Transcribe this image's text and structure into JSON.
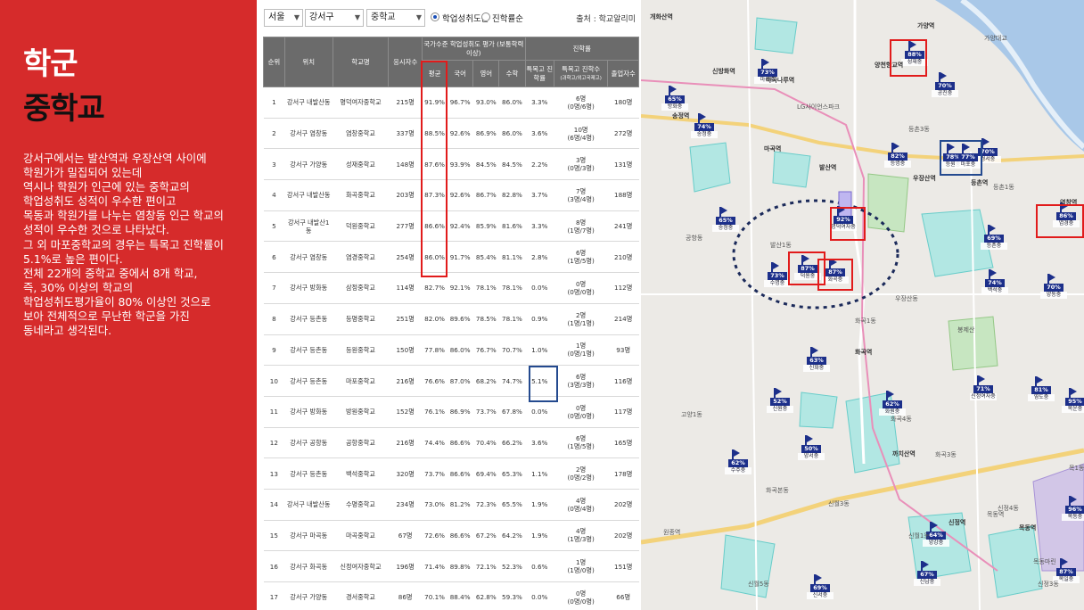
{
  "left_panel": {
    "title_main": "학군",
    "title_sub": "중학교",
    "description_lines": [
      "강서구에서는 발산역과 우장산역 사이에",
      "학원가가 밀집되어 있는데",
      "역시나 학원가 인근에 있는 중학교의",
      "학업성취도 성적이 우수한 편이고",
      "목동과 학원가를 나누는 염창동 인근 학교의",
      "성적이 우수한 것으로 나타났다.",
      "그 외 마포중학교의 경우는 특목고 진학률이",
      "5.1%로 높은 편이다.",
      "전체 22개의 중학교 중에서 8개 학교,",
      "즉, 30% 이상의 학교의",
      "학업성취도평가율이 80% 이상인 것으로",
      "보아 전체적으로 무난한 학군을 가진",
      "동네라고 생각된다."
    ]
  },
  "filters": {
    "city": "서울",
    "district": "강서구",
    "level": "중학교",
    "radio_1": "학업성취도순",
    "radio_2": "진학률순",
    "source": "출처 : 학교알리미"
  },
  "table": {
    "group_header_1": "국가수준 학업성취도 평가 (보통학력이상)",
    "group_header_2": "진학률",
    "headers": {
      "rank": "순위",
      "location": "위치",
      "school": "학교명",
      "examinees": "응시자수",
      "avg": "평균",
      "korean": "국어",
      "english": "영어",
      "math": "수학",
      "special_rate": "특목고 진학률",
      "special_count": "특목고 진학수",
      "special_count_sub": "(과학고/외고국제고)",
      "graduates": "졸업자수"
    },
    "rows": [
      {
        "rank": "1",
        "location": "강서구 내발산동",
        "school": "명덕여자중학교",
        "examinees": "215명",
        "avg": "91.9%",
        "korean": "96.7%",
        "english": "93.0%",
        "math": "86.0%",
        "special_rate": "3.3%",
        "count_top": "6명",
        "count_bot": "(0명/6명)",
        "graduates": "180명"
      },
      {
        "rank": "2",
        "location": "강서구 염창동",
        "school": "염창중학교",
        "examinees": "337명",
        "avg": "88.5%",
        "korean": "92.6%",
        "english": "86.9%",
        "math": "86.0%",
        "special_rate": "3.6%",
        "count_top": "10명",
        "count_bot": "(6명/4명)",
        "graduates": "272명"
      },
      {
        "rank": "3",
        "location": "강서구 가양동",
        "school": "성재중학교",
        "examinees": "148명",
        "avg": "87.6%",
        "korean": "93.9%",
        "english": "84.5%",
        "math": "84.5%",
        "special_rate": "2.2%",
        "count_top": "3명",
        "count_bot": "(0명/3명)",
        "graduates": "131명"
      },
      {
        "rank": "4",
        "location": "강서구 내발산동",
        "school": "화곡중학교",
        "examinees": "203명",
        "avg": "87.3%",
        "korean": "92.6%",
        "english": "86.7%",
        "math": "82.8%",
        "special_rate": "3.7%",
        "count_top": "7명",
        "count_bot": "(3명/4명)",
        "graduates": "188명"
      },
      {
        "rank": "5",
        "location": "강서구 내발산1동",
        "school": "덕원중학교",
        "examinees": "277명",
        "avg": "86.6%",
        "korean": "92.4%",
        "english": "85.9%",
        "math": "81.6%",
        "special_rate": "3.3%",
        "count_top": "8명",
        "count_bot": "(1명/7명)",
        "graduates": "241명"
      },
      {
        "rank": "6",
        "location": "강서구 염창동",
        "school": "염경중학교",
        "examinees": "254명",
        "avg": "86.0%",
        "korean": "91.7%",
        "english": "85.4%",
        "math": "81.1%",
        "special_rate": "2.8%",
        "count_top": "6명",
        "count_bot": "(1명/5명)",
        "graduates": "210명"
      },
      {
        "rank": "7",
        "location": "강서구 방화동",
        "school": "삼정중학교",
        "examinees": "114명",
        "avg": "82.7%",
        "korean": "92.1%",
        "english": "78.1%",
        "math": "78.1%",
        "special_rate": "0.0%",
        "count_top": "0명",
        "count_bot": "(0명/0명)",
        "graduates": "112명"
      },
      {
        "rank": "8",
        "location": "강서구 등촌동",
        "school": "등명중학교",
        "examinees": "251명",
        "avg": "82.0%",
        "korean": "89.6%",
        "english": "78.5%",
        "math": "78.1%",
        "special_rate": "0.9%",
        "count_top": "2명",
        "count_bot": "(1명/1명)",
        "graduates": "214명"
      },
      {
        "rank": "9",
        "location": "강서구 등촌동",
        "school": "등원중학교",
        "examinees": "150명",
        "avg": "77.8%",
        "korean": "86.0%",
        "english": "76.7%",
        "math": "70.7%",
        "special_rate": "1.0%",
        "count_top": "1명",
        "count_bot": "(0명/1명)",
        "graduates": "93명"
      },
      {
        "rank": "10",
        "location": "강서구 등촌동",
        "school": "마포중학교",
        "examinees": "216명",
        "avg": "76.6%",
        "korean": "87.0%",
        "english": "68.2%",
        "math": "74.7%",
        "special_rate": "5.1%",
        "count_top": "6명",
        "count_bot": "(3명/3명)",
        "graduates": "116명"
      },
      {
        "rank": "11",
        "location": "강서구 방화동",
        "school": "방원중학교",
        "examinees": "152명",
        "avg": "76.1%",
        "korean": "86.9%",
        "english": "73.7%",
        "math": "67.8%",
        "special_rate": "0.0%",
        "count_top": "0명",
        "count_bot": "(0명/0명)",
        "graduates": "117명"
      },
      {
        "rank": "12",
        "location": "강서구 공항동",
        "school": "공항중학교",
        "examinees": "216명",
        "avg": "74.4%",
        "korean": "86.6%",
        "english": "70.4%",
        "math": "66.2%",
        "special_rate": "3.6%",
        "count_top": "6명",
        "count_bot": "(1명/5명)",
        "graduates": "165명"
      },
      {
        "rank": "13",
        "location": "강서구 등촌동",
        "school": "백석중학교",
        "examinees": "320명",
        "avg": "73.7%",
        "korean": "86.6%",
        "english": "69.4%",
        "math": "65.3%",
        "special_rate": "1.1%",
        "count_top": "2명",
        "count_bot": "(0명/2명)",
        "graduates": "178명"
      },
      {
        "rank": "14",
        "location": "강서구 내발산동",
        "school": "수명중학교",
        "examinees": "234명",
        "avg": "73.0%",
        "korean": "81.2%",
        "english": "72.3%",
        "math": "65.5%",
        "special_rate": "1.9%",
        "count_top": "4명",
        "count_bot": "(0명/4명)",
        "graduates": "202명"
      },
      {
        "rank": "15",
        "location": "강서구 마곡동",
        "school": "마곡중학교",
        "examinees": "67명",
        "avg": "72.6%",
        "korean": "86.6%",
        "english": "67.2%",
        "math": "64.2%",
        "special_rate": "1.9%",
        "count_top": "4명",
        "count_bot": "(1명/3명)",
        "graduates": "202명"
      },
      {
        "rank": "16",
        "location": "강서구 화곡동",
        "school": "신정여자중학교",
        "examinees": "196명",
        "avg": "71.4%",
        "korean": "89.8%",
        "english": "72.1%",
        "math": "52.3%",
        "special_rate": "0.6%",
        "count_top": "1명",
        "count_bot": "(1명/0명)",
        "graduates": "151명"
      },
      {
        "rank": "17",
        "location": "강서구 가양동",
        "school": "경서중학교",
        "examinees": "86명",
        "avg": "70.1%",
        "korean": "88.4%",
        "english": "62.8%",
        "math": "59.3%",
        "special_rate": "0.0%",
        "count_top": "0명",
        "count_bot": "(0명/0명)",
        "graduates": "66명"
      }
    ]
  },
  "map": {
    "markers": [
      {
        "pct": "88%",
        "name": "성재중"
      },
      {
        "pct": "73%",
        "name": "마곡중"
      },
      {
        "pct": "70%",
        "name": "공진중"
      },
      {
        "pct": "65%",
        "name": "방화중"
      },
      {
        "pct": "74%",
        "name": "송정중"
      },
      {
        "pct": "82%",
        "name": "등명중"
      },
      {
        "pct": "70%",
        "name": "경서중"
      },
      {
        "pct": "78%",
        "name": "등원중"
      },
      {
        "pct": "77%",
        "name": "마포중"
      },
      {
        "pct": "65%",
        "name": "송정중"
      },
      {
        "pct": "92%",
        "name": "명덕여자중"
      },
      {
        "pct": "69%",
        "name": "등촌중"
      },
      {
        "pct": "86%",
        "name": "염경중"
      },
      {
        "pct": "73%",
        "name": "수명중"
      },
      {
        "pct": "87%",
        "name": "덕원중"
      },
      {
        "pct": "87%",
        "name": "화곡중"
      },
      {
        "pct": "74%",
        "name": "백석중"
      },
      {
        "pct": "70%",
        "name": "양동중"
      },
      {
        "pct": "63%",
        "name": "신화중"
      },
      {
        "pct": "52%",
        "name": "신원중"
      },
      {
        "pct": "71%",
        "name": "신정여자중"
      },
      {
        "pct": "81%",
        "name": "영도중"
      },
      {
        "pct": "95%",
        "name": "목운중"
      },
      {
        "pct": "62%",
        "name": "화원중"
      },
      {
        "pct": "50%",
        "name": "양서중"
      },
      {
        "pct": "62%",
        "name": "수주중"
      },
      {
        "pct": "64%",
        "name": "양강중"
      },
      {
        "pct": "67%",
        "name": "신남중"
      },
      {
        "pct": "69%",
        "name": "신서중"
      },
      {
        "pct": "96%",
        "name": "목동중"
      },
      {
        "pct": "87%",
        "name": "목일중"
      }
    ],
    "labels": {
      "l1": "개화산역",
      "l2": "신방화역",
      "l3": "마곡나루역",
      "l4": "LG사이언스파크",
      "l5": "양천향교역",
      "l6": "가양역",
      "l7": "송정역",
      "l8": "마곡역",
      "l9": "발산역",
      "l10": "우장산역",
      "l11": "화곡역",
      "l12": "까치산역",
      "l13": "신정역",
      "l14": "목동역",
      "l15": "등촌역",
      "l16": "염창역",
      "l17": "가양대교",
      "l18": "등촌3동",
      "l19": "화곡1동",
      "l20": "신월1동",
      "l21": "신정4동",
      "l22": "목동마린",
      "l23": "봉제산",
      "l24": "고양1동",
      "l25": "원종역",
      "l26": "신월3동",
      "l27": "신월5동",
      "l28": "신정3동",
      "l29": "화곡3동",
      "l30": "화곡4동",
      "l31": "화곡본동",
      "l32": "등촌1동",
      "l33": "발산1동",
      "l34": "우장산동",
      "l35": "공항동",
      "l36": "목1동",
      "l37": "목동역"
    }
  },
  "colors": {
    "accent_red": "#d62b2b",
    "highlight_red": "#e11b1b",
    "highlight_blue": "#244a8f",
    "marker_blue": "#1c2f8a"
  }
}
